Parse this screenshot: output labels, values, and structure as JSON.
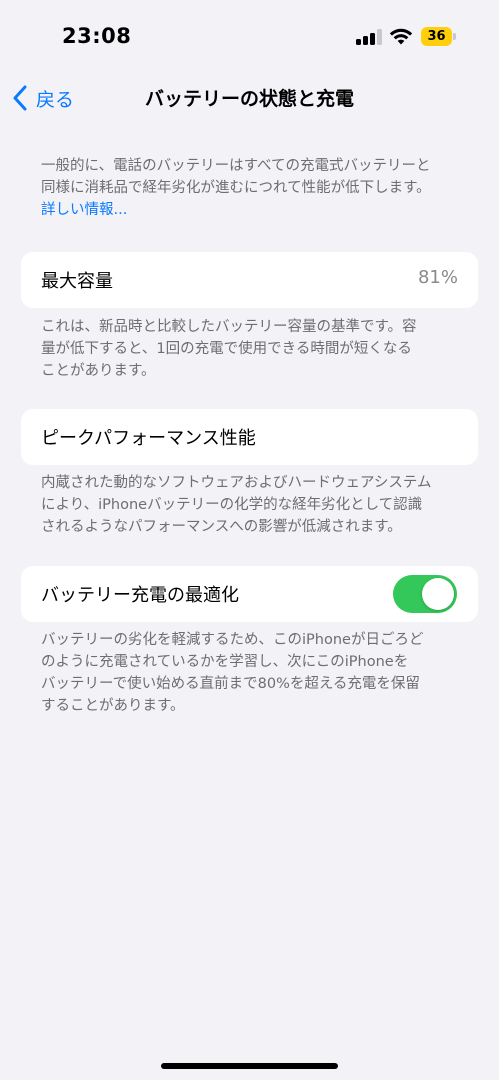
{
  "status_bar": {
    "time": "23:08",
    "battery_level": "36",
    "battery_color": "#fecf0a",
    "signal_bars_active": 3,
    "wifi_icon": "wifi-icon"
  },
  "nav": {
    "back_label": "戻る",
    "title": "バッテリーの状態と充電",
    "back_icon": "chevron-left-icon"
  },
  "intro": {
    "line1": "一般的に、電話のバッテリーはすべての充電式バッテリーと",
    "line2": "同様に消耗品で経年劣化が進むにつれて性能が低下します。",
    "link": "詳しい情報..."
  },
  "max_capacity": {
    "label": "最大容量",
    "value": "81%",
    "desc_line1": "これは、新品時と比較したバッテリー容量の基準です。容",
    "desc_line2": "量が低下すると、1回の充電で使用できる時間が短くなる",
    "desc_line3": "ことがあります。"
  },
  "peak_performance": {
    "label": "ピークパフォーマンス性能",
    "desc_line1": "内蔵された動的なソフトウェアおよびハードウェアシステム",
    "desc_line2": "により、iPhoneバッテリーの化学的な経年劣化として認識",
    "desc_line3": "されるようなパフォーマンスへの影響が低減されます。"
  },
  "optimized_charging": {
    "label": "バッテリー充電の最適化",
    "enabled": true,
    "toggle_color": "#34c759",
    "desc_line1": "バッテリーの劣化を軽減するため、このiPhoneが日ごろど",
    "desc_line2": "のように充電されているかを学習し、次にこのiPhoneを",
    "desc_line3": "バッテリーで使い始める直前まで80%を超える充電を保留",
    "desc_line4": "することがあります。"
  },
  "colors": {
    "background": "#f2f2f7",
    "accent": "#0a7aff",
    "secondary_text": "#6d6d72"
  }
}
